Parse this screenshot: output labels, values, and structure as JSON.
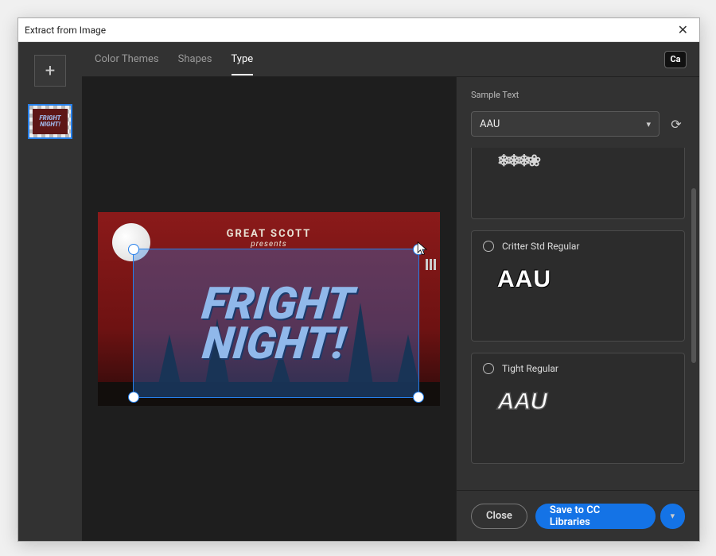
{
  "window": {
    "title": "Extract from Image"
  },
  "tabs": {
    "items": [
      {
        "label": "Color Themes",
        "active": false
      },
      {
        "label": "Shapes",
        "active": false
      },
      {
        "label": "Type",
        "active": true
      }
    ],
    "badge": "Ca"
  },
  "thumbnail": {
    "line1": "FRIGHT",
    "line2": "NIGHT!"
  },
  "canvas": {
    "presenter": "GREAT SCOTT",
    "subtitle": "presents",
    "line1": "FRIGHT",
    "line2": "NIGHT!"
  },
  "sample": {
    "label": "Sample Text",
    "value": "AAU"
  },
  "fonts": [
    {
      "name": "",
      "preview": "❄❄❄❀",
      "style": "fp-snow"
    },
    {
      "name": "Critter Std Regular",
      "preview": "AAU",
      "style": "fp-critter"
    },
    {
      "name": "Tight Regular",
      "preview": "AAU",
      "style": "fp-tight"
    }
  ],
  "footer": {
    "close": "Close",
    "save": "Save to CC Libraries"
  }
}
